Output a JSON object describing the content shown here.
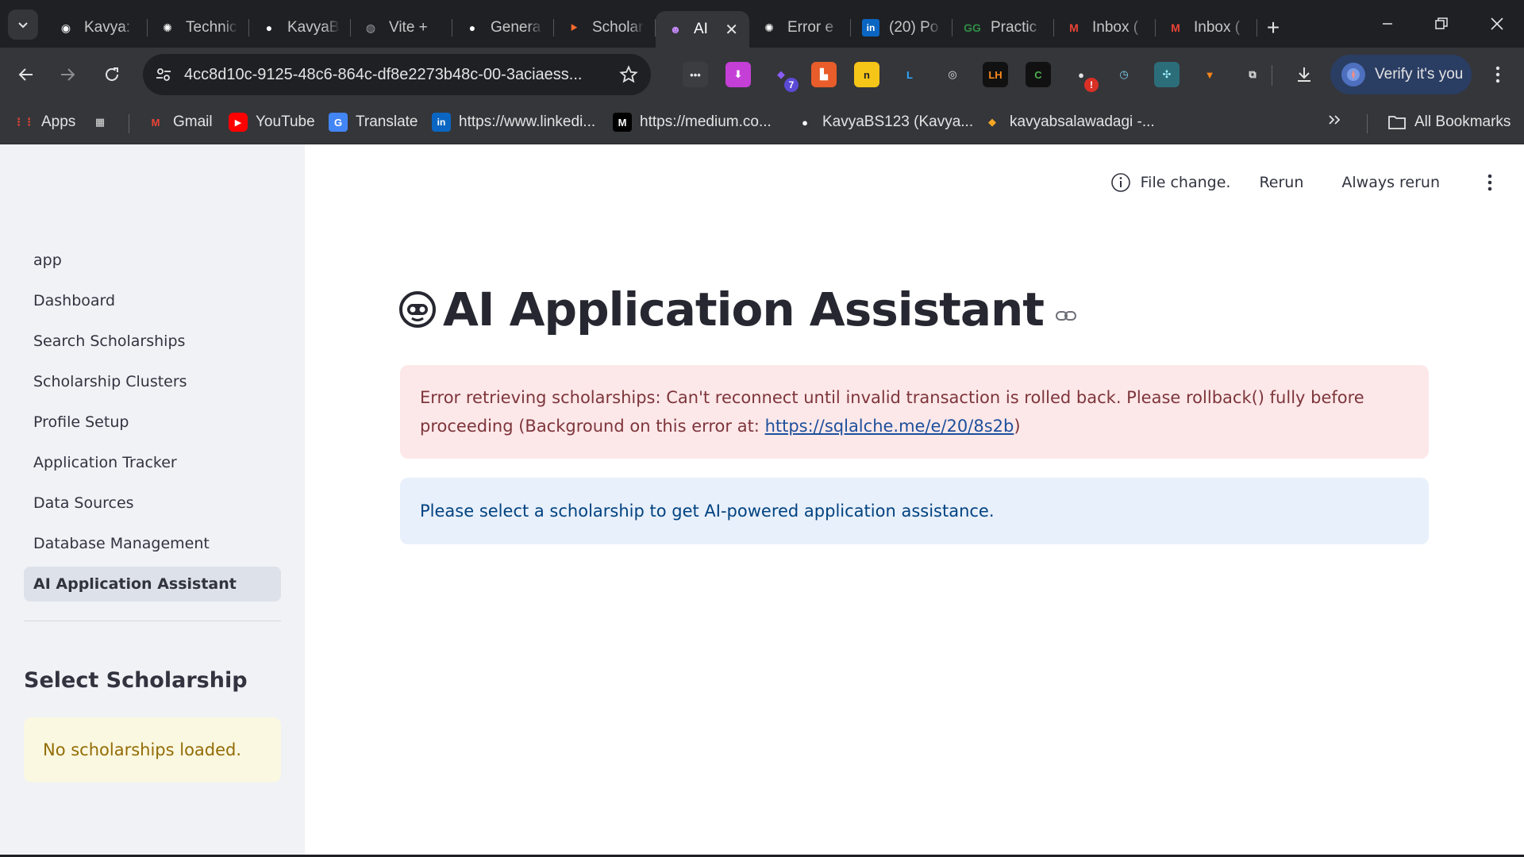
{
  "browser": {
    "tabs": [
      {
        "title": "Kavya: ",
        "icon": "chatgpt-swirl-icon",
        "color": "#ffffff"
      },
      {
        "title": "Technic",
        "icon": "openai-icon",
        "color": "#ffffff"
      },
      {
        "title": "KavyaB",
        "icon": "github-icon",
        "color": "#ffffff"
      },
      {
        "title": "Vite + ",
        "icon": "globe-icon",
        "color": "#9aa0a6"
      },
      {
        "title": "Genera",
        "icon": "github-icon",
        "color": "#ffffff"
      },
      {
        "title": "Scholar",
        "icon": "streamlit-icon",
        "color": "#ff6b2b"
      },
      {
        "title": "AI",
        "icon": "robot-icon",
        "color": "#c58af9",
        "active": true
      },
      {
        "title": "Error e",
        "icon": "openai-icon",
        "color": "#ffffff"
      },
      {
        "title": "(20) Po",
        "icon": "linkedin-icon",
        "color": "#0a66c2"
      },
      {
        "title": "Practic",
        "icon": "geeksforgeeks-icon",
        "color": "#2f8d46"
      },
      {
        "title": "Inbox (",
        "icon": "gmail-icon",
        "color": "#ea4335"
      },
      {
        "title": "Inbox (",
        "icon": "gmail-icon",
        "color": "#ea4335"
      }
    ],
    "url": "4cc8d10c-9125-48c6-864c-df8e2273b48c-00-3aciaess...",
    "verify_label": "Verify it's you",
    "extensions": [
      {
        "name": "dots-extension-icon",
        "glyph": "•••",
        "bg": "#3c3d41",
        "fg": "#e3e3e3"
      },
      {
        "name": "download-arrow-extension-icon",
        "glyph": "⬇",
        "bg": "#c43fd6",
        "fg": "#ffffff"
      },
      {
        "name": "shapes-extension-icon",
        "glyph": "◆",
        "bg": "transparent",
        "fg": "#8b5cf6",
        "badge": "7",
        "badge_color": "#5b4ad6"
      },
      {
        "name": "castle-extension-icon",
        "glyph": "▙",
        "bg": "#e85d2a",
        "fg": "#ffffff"
      },
      {
        "name": "scholar-extension-icon",
        "glyph": "n",
        "bg": "#f5c518",
        "fg": "#1f2024"
      },
      {
        "name": "l-extension-icon",
        "glyph": "L",
        "bg": "transparent",
        "fg": "#2ea7ff"
      },
      {
        "name": "target-extension-icon",
        "glyph": "◎",
        "bg": "transparent",
        "fg": "#e3e3e3"
      },
      {
        "name": "lighthouse-extension-icon",
        "glyph": "LH",
        "bg": "#111111",
        "fg": "#ff8a1c"
      },
      {
        "name": "leetcode-extension-icon",
        "glyph": "C",
        "bg": "#111111",
        "fg": "#4caf50"
      },
      {
        "name": "github-alert-extension-icon",
        "glyph": "●",
        "bg": "transparent",
        "fg": "#e3e3e3",
        "badge": "!",
        "badge_color": "#d93025"
      },
      {
        "name": "clock-extension-icon",
        "glyph": "◷",
        "bg": "transparent",
        "fg": "#7fd3f7"
      },
      {
        "name": "network-extension-icon",
        "glyph": "✣",
        "bg": "#2c6d7a",
        "fg": "#9ff0ff"
      },
      {
        "name": "fox-extension-icon",
        "glyph": "▼",
        "bg": "transparent",
        "fg": "#f6851b"
      },
      {
        "name": "puzzle-extension-icon",
        "glyph": "⧉",
        "bg": "transparent",
        "fg": "#e3e3e3"
      }
    ],
    "bookmarks": [
      {
        "label": "Apps",
        "icon": "apps-grid-icon",
        "color": "#ea4335"
      },
      {
        "label": "",
        "icon": "grid-icon",
        "color": "#e3e3e3"
      },
      {
        "label": "Gmail",
        "icon": "gmail-icon",
        "color": "#ea4335"
      },
      {
        "label": "YouTube",
        "icon": "youtube-icon",
        "color": "#ff0000"
      },
      {
        "label": "Translate",
        "icon": "translate-icon",
        "color": "#4285f4"
      },
      {
        "label": "https://www.linkedi...",
        "icon": "linkedin-icon",
        "color": "#0a66c2"
      },
      {
        "label": "https://medium.co...",
        "icon": "medium-icon",
        "color": "#ffffff"
      },
      {
        "label": "KavyaBS123 (Kavya...",
        "icon": "github-icon",
        "color": "#ffffff"
      },
      {
        "label": "kavyabsalawadagi -...",
        "icon": "hackerrank-icon",
        "color": "#f5a623"
      }
    ],
    "all_bookmarks_label": "All Bookmarks"
  },
  "sidebar": {
    "nav": [
      {
        "label": "app"
      },
      {
        "label": "Dashboard"
      },
      {
        "label": "Search Scholarships"
      },
      {
        "label": "Scholarship Clusters"
      },
      {
        "label": "Profile Setup"
      },
      {
        "label": "Application Tracker"
      },
      {
        "label": "Data Sources"
      },
      {
        "label": "Database Management"
      },
      {
        "label": "AI Application Assistant",
        "active": true
      }
    ],
    "select_heading": "Select Scholarship",
    "no_scholarships": "No scholarships loaded."
  },
  "status": {
    "file_change": "File change.",
    "rerun": "Rerun",
    "always_rerun": "Always rerun"
  },
  "main": {
    "title": "AI Application Assistant",
    "error_text": "Error retrieving scholarships: Can't reconnect until invalid transaction is rolled back. Please rollback() fully before proceeding (Background on this error at: ",
    "error_link": "https://sqlalche.me/e/20/8s2b",
    "error_suffix": ")",
    "info_text": "Please select a scholarship to get AI-powered application assistance."
  },
  "colors": {
    "error_bg": "#fde8e9",
    "error_fg": "#7d353b",
    "info_bg": "#e8f0fb",
    "info_fg": "#004280",
    "warning_bg": "#fbf8e1",
    "warning_fg": "#926c05",
    "sidebar_bg": "#f0f2f6"
  }
}
